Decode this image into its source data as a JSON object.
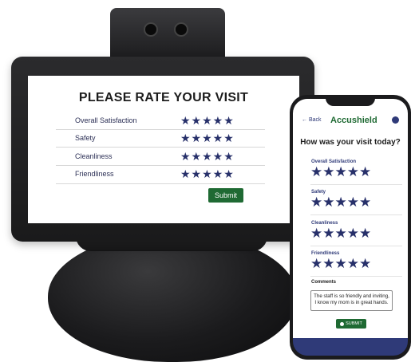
{
  "kiosk": {
    "title": "PLEASE RATE YOUR VISIT",
    "rows": [
      {
        "label": "Overall Satisfaction",
        "stars": "★★★★★"
      },
      {
        "label": "Safety",
        "stars": "★★★★★"
      },
      {
        "label": "Cleanliness",
        "stars": "★★★★★"
      },
      {
        "label": "Friendliness",
        "stars": "★★★★★"
      }
    ],
    "submit_label": "Submit"
  },
  "phone": {
    "back_label": "← Back",
    "brand": "Accushield",
    "question": "How was your visit today?",
    "categories": [
      {
        "label": "Overall Satisfaction",
        "stars": "★★★★★"
      },
      {
        "label": "Safety",
        "stars": "★★★★★"
      },
      {
        "label": "Cleanliness",
        "stars": "★★★★★"
      },
      {
        "label": "Friendliness",
        "stars": "★★★★★"
      }
    ],
    "comments_label": "Comments",
    "comments_line1": "The staff is so friendly and inviting,",
    "comments_line2": "I know my mom is in great hands.",
    "submit_label": "SUBMIT"
  },
  "colors": {
    "brand_green": "#1f6a33",
    "star_navy": "#27306a",
    "phone_accent": "#2f3a78"
  }
}
